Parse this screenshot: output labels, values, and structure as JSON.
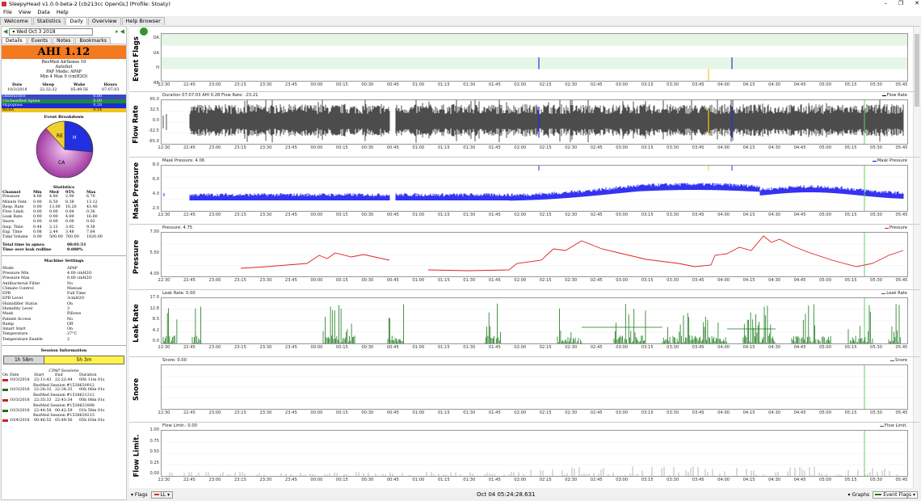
{
  "window": {
    "title": "SleepyHead v1.0.0-beta-2 [cb213cc OpenGL] (Profile: Stoaty)",
    "controls": [
      "–",
      "❐",
      "✕"
    ]
  },
  "menu": [
    "File",
    "View",
    "Data",
    "Help"
  ],
  "tabs": [
    "Welcome",
    "Statistics",
    "Daily",
    "Overview",
    "Help Browser"
  ],
  "active_tab": "Daily",
  "left": {
    "date": "Wed Oct 3 2018",
    "subtabs": [
      "Details",
      "Events",
      "Notes",
      "Bookmarks"
    ],
    "ahi": "AHI 1.12",
    "device_lines": [
      "ResMed AirSense 10",
      "AutoSet",
      "PAP Mode: APAP",
      "Min 4 Max 9 (cmH2O)"
    ],
    "date_headers": [
      "Date",
      "Sleep",
      "Wake",
      "Hours"
    ],
    "date_values": [
      "10/3/2018",
      "22:32:32",
      "05:49:56",
      "07:07:03"
    ],
    "events": [
      {
        "name": "Obstructive",
        "value": "0.00",
        "color": "#3a48c8"
      },
      {
        "name": "Unclassified Apnea",
        "value": "0.00",
        "color": "#1a8a3c"
      },
      {
        "name": "Hypopnea",
        "value": "0.28",
        "color": "#1f2ad8"
      },
      {
        "name": "RERA",
        "value": "0.14",
        "color": "#f0c419"
      }
    ],
    "breakdown_title": "Event Breakdown",
    "pie_labels": {
      "re": "RE",
      "h": "H",
      "ca": "CA"
    },
    "statistics_title": "Statistics",
    "stats_headers": [
      "Channel",
      "Min",
      "Med",
      "95%",
      "Max"
    ],
    "stats_rows": [
      [
        "Pressure",
        "4.06",
        "4.80",
        "2.90",
        "6.70"
      ],
      [
        "Minute Vent.",
        "0.00",
        "6.50",
        "8.38",
        "13.12"
      ],
      [
        "Resp. Rate",
        "0.00",
        "13.00",
        "16.20",
        "43.40"
      ],
      [
        "Flow Limit.",
        "0.00",
        "0.00",
        "0.04",
        "0.36"
      ],
      [
        "Leak Rate",
        "0.00",
        "0.00",
        "4.80",
        "16.80"
      ],
      [
        "Snore",
        "0.00",
        "0.00",
        "0.00",
        "0.02"
      ],
      [
        "Insp. Time",
        "0.44",
        "2.12",
        "3.92",
        "9.38"
      ],
      [
        "Exp. Time",
        "0.08",
        "2.44",
        "3.48",
        "7.64"
      ],
      [
        "Tidal Volume",
        "0.00",
        "500.00",
        "760.00",
        "1820.00"
      ]
    ],
    "apnea_rows": [
      [
        "Total time in apnea",
        "00:01:51"
      ],
      [
        "Time over leak redline",
        "0.000%"
      ]
    ],
    "machine_title": "Machine Settings",
    "machine_settings": [
      [
        "Mode",
        "APAP"
      ],
      [
        "Pressure Min",
        "4.00 cmH2O"
      ],
      [
        "Pressure Max",
        "9.00 cmH2O"
      ],
      [
        "Antibacterial Filter",
        "No"
      ],
      [
        "Climate Control",
        "Manual"
      ],
      [
        "EPR",
        "Full Time"
      ],
      [
        "EPR Level",
        "3cmH2O"
      ],
      [
        "Humidifier Status",
        "On"
      ],
      [
        "Humidity Level",
        "3"
      ],
      [
        "Mask",
        "Pillows"
      ],
      [
        "Patient Access",
        "No"
      ],
      [
        "Ramp",
        "Off"
      ],
      [
        "Smart Start",
        "On"
      ],
      [
        "Temperature",
        "27°C"
      ],
      [
        "Temperature Enable",
        "2"
      ]
    ],
    "session_title": "Session Information",
    "session_bar": [
      "1h 58m",
      "5h 3m"
    ],
    "cpap_title": "CPAP Sessions",
    "session_headers": [
      "On",
      "Date",
      "Start",
      "End",
      "Duration"
    ],
    "sessions": [
      {
        "date": "10/3/2018",
        "start": "22:11:43",
        "end": "22:22:44",
        "dur": "00h 11m 01s",
        "name": "ResMed Session #1538630912",
        "color": "#cc2222"
      },
      {
        "date": "10/3/2018",
        "start": "22:28:32",
        "end": "22:34:33",
        "dur": "00h 06m 01s",
        "name": "ResMed Session #1538631312",
        "color": "#2a6a1a"
      },
      {
        "date": "10/3/2018",
        "start": "22:35:33",
        "end": "22:43:34",
        "dur": "00h 08m 01s",
        "name": "ResMed Session #1538631898",
        "color": "#cc2222"
      },
      {
        "date": "10/3/2018",
        "start": "22:44:58",
        "end": "00:42:59",
        "dur": "01h 58m 01s",
        "name": "ResMed Session #1538639215",
        "color": "#2a6a1a"
      },
      {
        "date": "10/4/2018",
        "start": "00:46:55",
        "end": "05:49:56",
        "dur": "05h 03m 01s",
        "name": "",
        "color": "#cc2222"
      }
    ]
  },
  "graphs": {
    "x_ticks": [
      "22:30",
      "22:45",
      "23:00",
      "23:15",
      "23:30",
      "23:45",
      "00:00",
      "00:15",
      "00:30",
      "00:45",
      "01:00",
      "01:15",
      "01:30",
      "01:45",
      "02:00",
      "02:15",
      "02:30",
      "02:45",
      "03:00",
      "03:15",
      "03:30",
      "03:45",
      "04:00",
      "04:15",
      "04:30",
      "04:45",
      "05:00",
      "05:15",
      "05:30",
      "05:45"
    ],
    "event_flags": {
      "title": "Event Flags",
      "rows": [
        "OA",
        "UA",
        "H",
        "RE"
      ]
    },
    "flow_rate": {
      "title": "Flow Rate",
      "header": "Duration 07:07:03 AHI 0.28 Flow Rate: -23.21",
      "legend": "Flow Rate",
      "y_ticks": [
        "65.0",
        "32.5",
        "0.0",
        "-32.5",
        "-65.0"
      ],
      "color": "#000000"
    },
    "mask_pressure": {
      "title": "Mask Pressure",
      "header": "Mask Pressure: 4.06",
      "legend": "Mask Pressure",
      "y_ticks": [
        "8.0",
        "6.0",
        "4.0",
        "2.0"
      ],
      "color": "#0000ee"
    },
    "pressure": {
      "title": "Pressure",
      "header": "Pressure: 4.75",
      "legend": "Pressure",
      "y_ticks": [
        "7.00",
        "5.50",
        "4.00"
      ],
      "color": "#e02020"
    },
    "leak_rate": {
      "title": "Leak Rate",
      "header": "Leak Rate: 0.00",
      "legend": "Leak Rate",
      "y_ticks": [
        "17.0",
        "12.8",
        "8.5",
        "4.2",
        "0.0"
      ],
      "color": "#1a7a1a"
    },
    "snore": {
      "title": "Snore",
      "header": "Snore: 0.00",
      "legend": "Snore",
      "y_ticks": []
    },
    "flow_limit": {
      "title": "Flow Limit.",
      "header": "Flow Limit.: 0.00",
      "legend": "Flow Limit.",
      "y_ticks": [
        "1.00",
        "0.75",
        "0.50",
        "0.25",
        "0.00"
      ]
    }
  },
  "bottom": {
    "flags_label": "Flags",
    "ll_label": "LL",
    "timestamp": "Oct 04 05:24:28.631",
    "graphs_label": "Graphs",
    "eventflags_label": "Event Flags"
  }
}
